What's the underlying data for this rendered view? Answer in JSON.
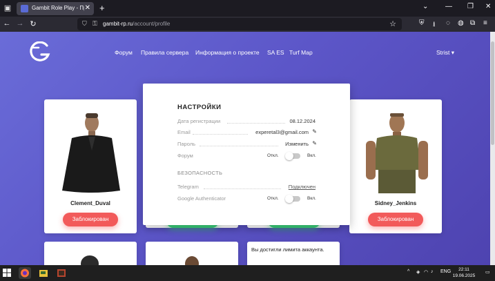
{
  "browser": {
    "tab_title": "Gambit Role Play - Профиль U...",
    "url_host": "gambit-rp.ru",
    "url_path": "/account/profile"
  },
  "site": {
    "nav": [
      "Форум",
      "Правила сервера",
      "Информация о проекте",
      "SA ES",
      "Turf Map"
    ],
    "user": "Strist"
  },
  "characters": {
    "left": {
      "name": "Clement_Duval",
      "button": "Заблокирован"
    },
    "right": {
      "name": "Sidney_Jenkins",
      "button": "Заблокирован"
    }
  },
  "limit_card": {
    "text": "Вы достигли лимита аккаунта."
  },
  "settings": {
    "title": "НАСТРОЙКИ",
    "reg_label": "Дата регистрации",
    "reg_value": "08.12.2024",
    "email_label": "Email",
    "email_value": "experetal3@gmail.com",
    "password_label": "Пароль",
    "password_value": "Изменить",
    "forum_label": "Форум",
    "toggle_off": "Откл.",
    "toggle_on": "Вкл.",
    "security_title": "БЕЗОПАСНОСТЬ",
    "telegram_label": "Telegram",
    "telegram_value": "Подключен",
    "ga_label": "Google Authenticator"
  },
  "taskbar": {
    "lang": "ENG",
    "time": "22:11",
    "date": "19.06.2025"
  },
  "colors": {
    "page_gradient_start": "#6a6cd8",
    "page_gradient_end": "#4e43b0",
    "ban_button": "#f25a5a",
    "green_button": "#3ad07a"
  }
}
